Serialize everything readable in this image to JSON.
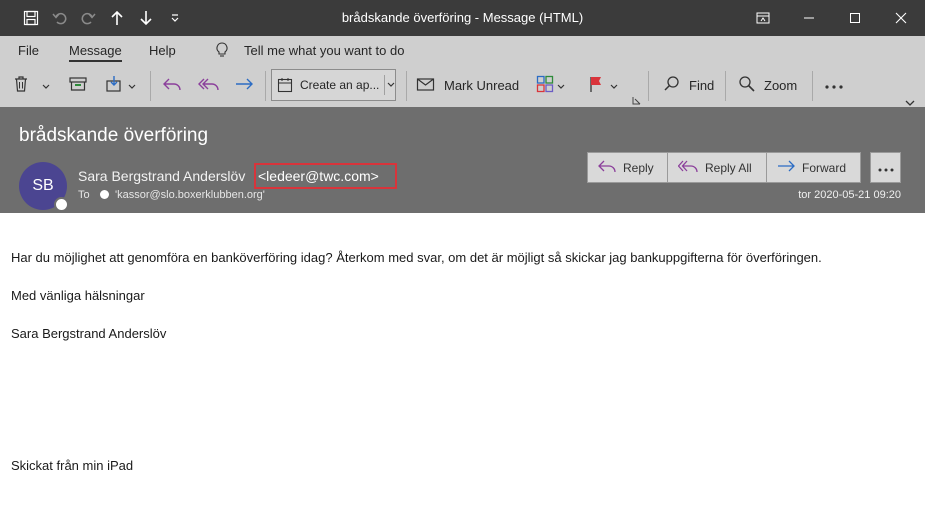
{
  "window": {
    "title": "brådskande överföring  -  Message (HTML)"
  },
  "menu": {
    "items": [
      "File",
      "Message",
      "Help"
    ],
    "active": "Message",
    "tell_me": "Tell me what you want to do"
  },
  "ribbon": {
    "create_label": "Create an ap...",
    "mark_unread": "Mark Unread",
    "find": "Find",
    "zoom": "Zoom"
  },
  "message": {
    "subject": "brådskande överföring",
    "avatar_initials": "SB",
    "sender_name": "Sara Bergstrand Anderslöv",
    "sender_email": "<ledeer@twc.com>",
    "to_label": "To",
    "recipient": "'kassor@slo.boxerklubben.org'",
    "date": "tor 2020-05-21 09:20",
    "actions": {
      "reply": "Reply",
      "reply_all": "Reply All",
      "forward": "Forward"
    },
    "body": [
      "Har du möjlighet att genomföra en banköverföring idag? Återkom med svar, om det är möjligt så skickar jag bankuppgifterna för överföringen.",
      "Med vänliga hälsningar",
      "Sara Bergstrand Anderslöv",
      "Skickat från min iPad"
    ]
  },
  "colors": {
    "titlebar": "#3b3b3b",
    "ribbon": "#cfcfcf",
    "header": "#6e6e6e",
    "avatar": "#4b4591",
    "highlight_border": "#d9343b",
    "reply_icon": "#8b3f9b",
    "forward_icon": "#2b6cc4"
  },
  "icons": [
    "save-icon",
    "undo-icon",
    "redo-icon",
    "previous-item-icon",
    "next-item-icon",
    "customize-toolbar-icon",
    "restore-ribbon-icon",
    "minimize-icon",
    "maximize-icon",
    "close-icon",
    "lightbulb-icon",
    "delete-icon",
    "archive-icon",
    "move-icon",
    "reply-icon",
    "reply-all-icon",
    "forward-icon",
    "calendar-icon",
    "envelope-icon",
    "categorize-icon",
    "flag-icon",
    "search-icon",
    "zoom-icon",
    "more-icon",
    "collapse-ribbon-icon"
  ]
}
